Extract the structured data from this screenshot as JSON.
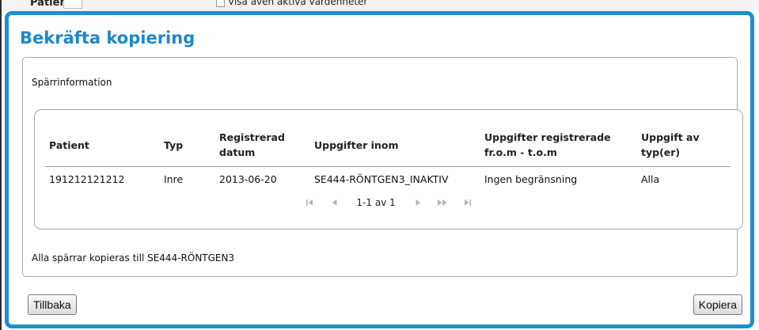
{
  "background": {
    "patient_label": "Patient",
    "checkbox_label": "Visa även aktiva vårdenheter"
  },
  "dialog": {
    "title": "Bekräfta kopiering",
    "section_label": "Spärrinformation",
    "table": {
      "columns": [
        [
          "Patient"
        ],
        [
          "Typ"
        ],
        [
          "Registrerad",
          "datum"
        ],
        [
          "Uppgifter inom"
        ],
        [
          "Uppgifter registrerade",
          "fr.o.m - t.o.m"
        ],
        [
          "Uppgift av",
          "typ(er)"
        ]
      ],
      "rows": [
        [
          "191212121212",
          "Inre",
          "2013-06-20",
          "SE444-RÖNTGEN3_INAKTIV",
          "Ingen begränsning",
          "Alla"
        ]
      ]
    },
    "pager": {
      "text": "1-1 av 1"
    },
    "footer_text": "Alla spärrar kopieras till SE444-RÖNTGEN3",
    "buttons": {
      "back": "Tillbaka",
      "copy": "Kopiera"
    }
  },
  "colors": {
    "accent": "#1e8fd0",
    "title": "#1e88c8"
  }
}
